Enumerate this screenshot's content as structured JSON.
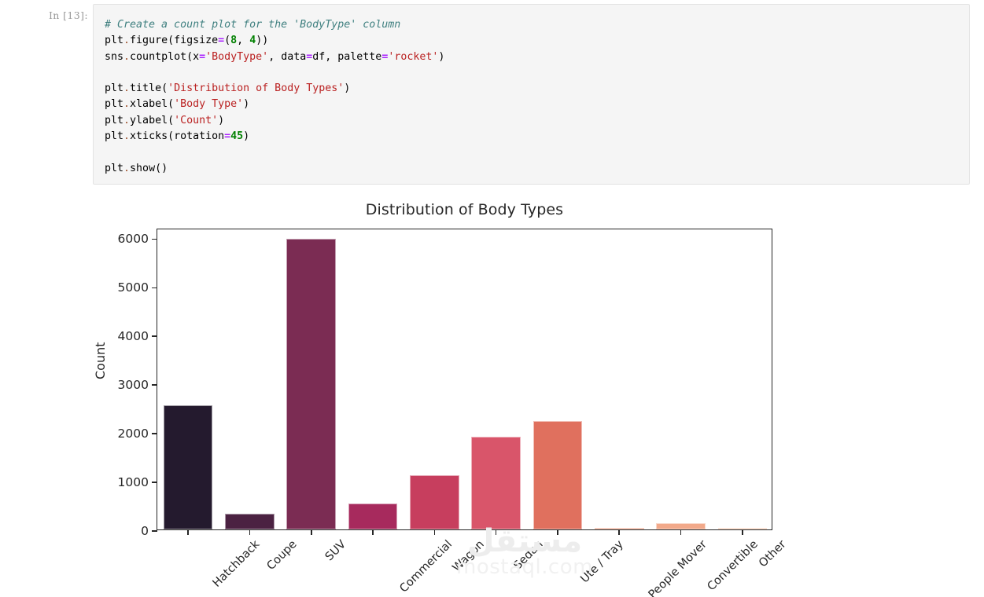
{
  "notebook": {
    "prompt_label": "In [13]:",
    "code_lines": [
      {
        "segments": [
          {
            "t": "# Create a count plot for the 'BodyType' column",
            "c": "c-com"
          }
        ]
      },
      {
        "segments": [
          {
            "t": "plt",
            "c": "c-nm"
          },
          {
            "t": ".",
            "c": "c-dot"
          },
          {
            "t": "figure(figsize",
            "c": "c-nm"
          },
          {
            "t": "=",
            "c": "c-op"
          },
          {
            "t": "(",
            "c": "c-nm"
          },
          {
            "t": "8",
            "c": "c-num"
          },
          {
            "t": ", ",
            "c": "c-nm"
          },
          {
            "t": "4",
            "c": "c-num"
          },
          {
            "t": "))",
            "c": "c-nm"
          }
        ]
      },
      {
        "segments": [
          {
            "t": "sns",
            "c": "c-nm"
          },
          {
            "t": ".",
            "c": "c-dot"
          },
          {
            "t": "countplot(x",
            "c": "c-nm"
          },
          {
            "t": "=",
            "c": "c-op"
          },
          {
            "t": "'BodyType'",
            "c": "c-str"
          },
          {
            "t": ", data",
            "c": "c-nm"
          },
          {
            "t": "=",
            "c": "c-op"
          },
          {
            "t": "df, palette",
            "c": "c-nm"
          },
          {
            "t": "=",
            "c": "c-op"
          },
          {
            "t": "'rocket'",
            "c": "c-str"
          },
          {
            "t": ")",
            "c": "c-nm"
          }
        ]
      },
      {
        "segments": [
          {
            "t": "",
            "c": "c-nm"
          }
        ]
      },
      {
        "segments": [
          {
            "t": "plt",
            "c": "c-nm"
          },
          {
            "t": ".",
            "c": "c-dot"
          },
          {
            "t": "title(",
            "c": "c-nm"
          },
          {
            "t": "'Distribution of Body Types'",
            "c": "c-str"
          },
          {
            "t": ")",
            "c": "c-nm"
          }
        ]
      },
      {
        "segments": [
          {
            "t": "plt",
            "c": "c-nm"
          },
          {
            "t": ".",
            "c": "c-dot"
          },
          {
            "t": "xlabel(",
            "c": "c-nm"
          },
          {
            "t": "'Body Type'",
            "c": "c-str"
          },
          {
            "t": ")",
            "c": "c-nm"
          }
        ]
      },
      {
        "segments": [
          {
            "t": "plt",
            "c": "c-nm"
          },
          {
            "t": ".",
            "c": "c-dot"
          },
          {
            "t": "ylabel(",
            "c": "c-nm"
          },
          {
            "t": "'Count'",
            "c": "c-str"
          },
          {
            "t": ")",
            "c": "c-nm"
          }
        ]
      },
      {
        "segments": [
          {
            "t": "plt",
            "c": "c-nm"
          },
          {
            "t": ".",
            "c": "c-dot"
          },
          {
            "t": "xticks(rotation",
            "c": "c-nm"
          },
          {
            "t": "=",
            "c": "c-op"
          },
          {
            "t": "45",
            "c": "c-num"
          },
          {
            "t": ")",
            "c": "c-nm"
          }
        ]
      },
      {
        "segments": [
          {
            "t": "",
            "c": "c-nm"
          }
        ]
      },
      {
        "segments": [
          {
            "t": "plt",
            "c": "c-nm"
          },
          {
            "t": ".",
            "c": "c-dot"
          },
          {
            "t": "show()",
            "c": "c-nm"
          }
        ]
      }
    ]
  },
  "watermark": {
    "arabic": "مستقل",
    "latin": "mostaql.com"
  },
  "chart_data": {
    "type": "bar",
    "title": "Distribution of Body Types",
    "xlabel": "Body Type",
    "ylabel": "Count",
    "categories": [
      "Hatchback",
      "Coupe",
      "SUV",
      "Commercial",
      "Wagon",
      "Sedan",
      "Ute / Tray",
      "People Mover",
      "Convertible",
      "Other"
    ],
    "values": [
      2550,
      320,
      5970,
      530,
      1110,
      1905,
      2225,
      25,
      130,
      10
    ],
    "colors": [
      "#241a2e",
      "#4b2242",
      "#7b2c53",
      "#a72a5d",
      "#c73e5e",
      "#d9556a",
      "#e0705e",
      "#ec8c6a",
      "#f2a98a",
      "#f6c0a2"
    ],
    "ylim": [
      0,
      6200
    ],
    "yticks": [
      0,
      1000,
      2000,
      3000,
      4000,
      5000,
      6000
    ],
    "ytick_labels": [
      "0",
      "1000",
      "2000",
      "3000",
      "4000",
      "5000",
      "6000"
    ],
    "grid": false,
    "xtick_rotation": 45,
    "legend": null
  }
}
